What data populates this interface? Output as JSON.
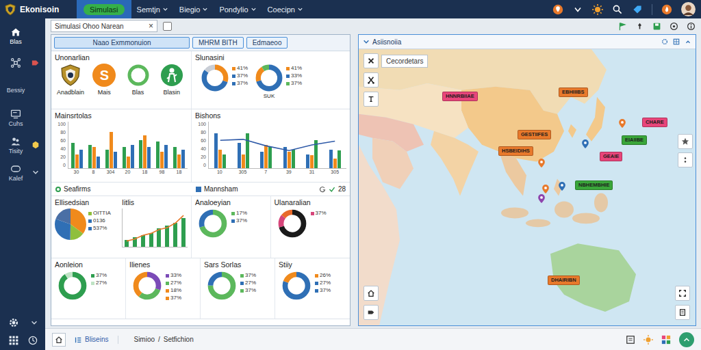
{
  "app": {
    "name": "Ekonisoin"
  },
  "nav_tabs": [
    {
      "label": "Simulasi",
      "selected": true,
      "caret": false
    },
    {
      "label": "Semtjn",
      "selected": false,
      "caret": true
    },
    {
      "label": "Biegio",
      "selected": false,
      "caret": true
    },
    {
      "label": "Pondylio",
      "selected": false,
      "caret": true
    },
    {
      "label": "Coecipn",
      "selected": false,
      "caret": true
    }
  ],
  "sidebar": {
    "items": [
      {
        "label": "Blas",
        "selected": true
      },
      {
        "label": "",
        "selected": false
      },
      {
        "label": "Bessiy",
        "selected": false
      },
      {
        "label": "Cuhs",
        "selected": false
      },
      {
        "label": "Tisity",
        "selected": false
      },
      {
        "label": "Kalef",
        "selected": false
      }
    ]
  },
  "toolbar": {
    "tab_title": "Simulasi Ohoo Narean",
    "close": "×",
    "checked": false
  },
  "dashboard": {
    "tabs": [
      {
        "label": "Naao Exmmonuion",
        "selected": true
      },
      {
        "label": "MHRM BITH",
        "selected": false
      },
      {
        "label": "Edmaeoo",
        "selected": false
      }
    ],
    "top_cards": [
      {
        "kind": "icons",
        "title": "Unonarlian",
        "items": [
          {
            "kind": "crest",
            "label": "Anadblain",
            "color": "#b8912a"
          },
          {
            "kind": "letter",
            "label": "Mais",
            "color": "#f08a1c",
            "glyph": "S"
          },
          {
            "kind": "ring",
            "label": "Blas",
            "color": "#5cb85c"
          },
          {
            "kind": "figure",
            "label": "Blasin",
            "color": "#2e9e4f"
          }
        ]
      },
      {
        "kind": "donut-pair",
        "title": "Slunasini",
        "donuts": [
          {
            "caption": "",
            "segments": [
              {
                "value": 30,
                "color": "#f08a1c"
              },
              {
                "value": 55,
                "color": "#2f6fb5"
              },
              {
                "value": 15,
                "color": "#c9ced6"
              }
            ],
            "readings": [
              {
                "text": "41%",
                "color": "#f08a1c"
              },
              {
                "text": "37%",
                "color": "#2f6fb5"
              },
              {
                "text": "37%",
                "color": "#2f6fb5"
              }
            ]
          },
          {
            "caption": "SUK",
            "segments": [
              {
                "value": 70,
                "color": "#2f6fb5"
              },
              {
                "value": 20,
                "color": "#f08a1c"
              },
              {
                "value": 10,
                "color": "#5cb85c"
              }
            ],
            "readings": [
              {
                "text": "41%",
                "color": "#f08a1c"
              },
              {
                "text": "33%",
                "color": "#2f6fb5"
              },
              {
                "text": "37%",
                "color": "#5cb85c"
              }
            ]
          }
        ]
      }
    ],
    "chart_cards": [
      {
        "kind": "bars",
        "title": "Mainsrtolas",
        "y_ticks": [
          "100",
          "80",
          "60",
          "40",
          "20",
          "0"
        ],
        "x_labels": [
          "30",
          "8",
          "304",
          "20",
          "18",
          "98",
          "18"
        ],
        "series": [
          {
            "color": "#2e9e4f",
            "values": [
              55,
              50,
              40,
              45,
              60,
              58,
              45
            ]
          },
          {
            "color": "#f08a1c",
            "values": [
              30,
              45,
              78,
              25,
              70,
              35,
              30
            ]
          },
          {
            "color": "#2f6fb5",
            "values": [
              40,
              25,
              35,
              50,
              45,
              50,
              40
            ]
          }
        ],
        "line": null
      },
      {
        "kind": "bars",
        "title": "Bishons",
        "y_ticks": [
          "100",
          "80",
          "60",
          "40",
          "20",
          "0"
        ],
        "x_labels": [
          "10",
          "305",
          "7",
          "39",
          "31",
          "305"
        ],
        "series": [
          {
            "color": "#2f6fb5",
            "values": [
              75,
              55,
              35,
              45,
              30,
              40
            ]
          },
          {
            "color": "#f08a1c",
            "values": [
              40,
              30,
              50,
              35,
              28,
              20
            ]
          },
          {
            "color": "#2e9e4f",
            "values": [
              30,
              75,
              45,
              40,
              60,
              38
            ]
          }
        ],
        "line": {
          "color": "#2f5aa8",
          "values": [
            60,
            62,
            48,
            38,
            50,
            58
          ]
        }
      }
    ],
    "legend": {
      "items": [
        {
          "kind": "ring",
          "label": "Seafirms",
          "color": "#2e9e4f"
        },
        {
          "kind": "square",
          "label": "Mannsham",
          "color": "#2f6fb5"
        }
      ],
      "count": "28"
    },
    "middle_cards": [
      {
        "kind": "pie-bars",
        "title": "Ellisedsian",
        "segments": [
          {
            "value": 35,
            "color": "#f08a1c"
          },
          {
            "value": 15,
            "color": "#8fbf3c"
          },
          {
            "value": 30,
            "color": "#2f6fb5"
          },
          {
            "value": 20,
            "color": "#4a6fa5"
          }
        ],
        "readings": [
          {
            "text": "OITTIA",
            "color": "#8fbf3c"
          },
          {
            "text": "0136",
            "color": "#2f6fb5"
          },
          {
            "text": "537%",
            "color": "#2f6fb5"
          }
        ],
        "mini": {
          "title": "Iitlis",
          "color": "#2e9e4f",
          "values": [
            18,
            25,
            30,
            35,
            48,
            55,
            62,
            75
          ],
          "trend_color": "#e8792b",
          "trend": [
            15,
            20,
            30,
            35,
            45,
            50,
            62,
            82
          ]
        }
      },
      {
        "kind": "donut",
        "title": "Analoeyian",
        "segments": [
          {
            "value": 70,
            "color": "#5cb85c"
          },
          {
            "value": 30,
            "color": "#2f6fb5"
          }
        ],
        "readings": [
          {
            "text": "17%",
            "color": "#5cb85c"
          },
          {
            "text": "37%",
            "color": "#2f6fb5"
          }
        ]
      },
      {
        "kind": "donut",
        "title": "Ulanaralian",
        "segments": [
          {
            "value": 70,
            "color": "#1a1a1a"
          },
          {
            "value": 15,
            "color": "#d6457a"
          },
          {
            "value": 15,
            "color": "#e86a2b"
          }
        ],
        "readings": [
          {
            "text": "37%",
            "color": "#d6457a"
          }
        ]
      }
    ],
    "bottom_cards": [
      {
        "kind": "donut",
        "title": "Aonleion",
        "segments": [
          {
            "value": 90,
            "color": "#2e9e4f"
          },
          {
            "value": 10,
            "color": "#bfe3c5"
          }
        ],
        "readings": [
          {
            "text": "37%",
            "color": "#2e9e4f"
          },
          {
            "text": "27%",
            "color": "#bfe3c5"
          }
        ]
      },
      {
        "kind": "donut",
        "title": "Ilienes",
        "segments": [
          {
            "value": 30,
            "color": "#7b4bb7"
          },
          {
            "value": 30,
            "color": "#5cb85c"
          },
          {
            "value": 40,
            "color": "#f08a1c"
          }
        ],
        "readings": [
          {
            "text": "33%",
            "color": "#7b4bb7"
          },
          {
            "text": "27%",
            "color": "#5cb85c"
          },
          {
            "text": "18%",
            "color": "#f08a1c"
          },
          {
            "text": "37%",
            "color": "#f08a1c"
          }
        ]
      },
      {
        "kind": "donut",
        "title": "Sars Sorlas",
        "segments": [
          {
            "value": 75,
            "color": "#5cb85c"
          },
          {
            "value": 25,
            "color": "#2f6fb5"
          }
        ],
        "readings": [
          {
            "text": "37%",
            "color": "#5cb85c"
          },
          {
            "text": "27%",
            "color": "#2f6fb5"
          },
          {
            "text": "37%",
            "color": "#5cb85c"
          }
        ]
      },
      {
        "kind": "donut",
        "title": "Stiiy",
        "segments": [
          {
            "value": 80,
            "color": "#2f6fb5"
          },
          {
            "value": 20,
            "color": "#f08a1c"
          }
        ],
        "readings": [
          {
            "text": "26%",
            "color": "#f08a1c"
          },
          {
            "text": "27%",
            "color": "#2f6fb5"
          },
          {
            "text": "37%",
            "color": "#2f6fb5"
          }
        ]
      }
    ]
  },
  "map": {
    "title": "Asiisnoiia",
    "tool_label": "Cecordetars",
    "markers": [
      {
        "label": "HNNRBIIAE",
        "color": "#e8457a"
      },
      {
        "label": "EBHIIIBS",
        "color": "#e8792b"
      },
      {
        "label": "GESTIIFES",
        "color": "#e8792b"
      },
      {
        "label": "HSBEIDIHS",
        "color": "#e8792b"
      },
      {
        "label": "CHARE",
        "color": "#e8457a"
      },
      {
        "label": "EIAIIBE",
        "color": "#3aa63a"
      },
      {
        "label": "GEAIE",
        "color": "#e8457a"
      },
      {
        "label": "NBHEMBHIE",
        "color": "#3aa63a"
      },
      {
        "label": "DHAIRIBN",
        "color": "#e8792b"
      }
    ]
  },
  "bottom_bar": {
    "section": "Bliseins",
    "breadcrumb": [
      "Simioo",
      "Setfichion"
    ],
    "separator": "/"
  }
}
